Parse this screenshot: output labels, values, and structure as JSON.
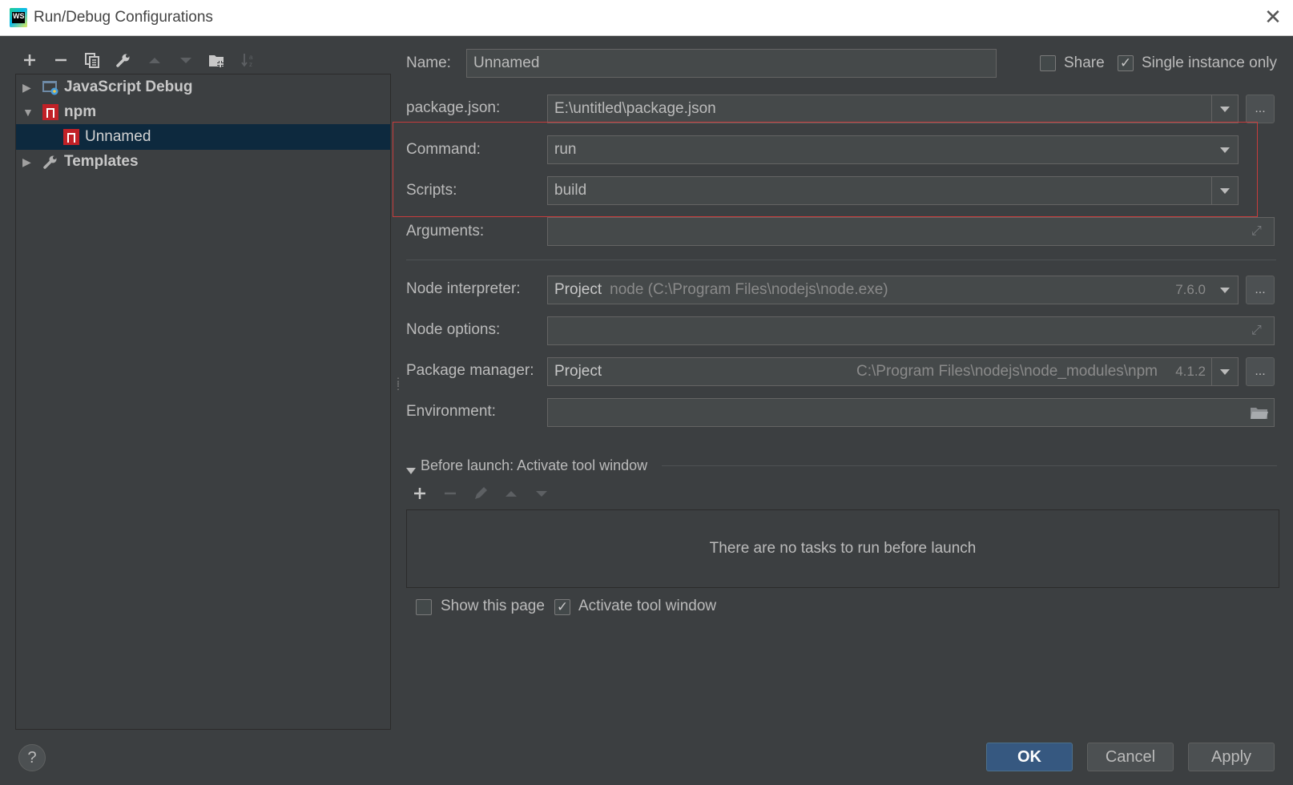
{
  "window": {
    "title": "Run/Debug Configurations",
    "logo_text": "WS"
  },
  "left_toolbar": [
    "add-icon",
    "remove-icon",
    "copy-icon",
    "wrench-icon",
    "move-up-icon",
    "move-down-icon",
    "new-folder-icon",
    "sort-icon"
  ],
  "tree": {
    "items": [
      {
        "label": "JavaScript Debug",
        "expanded": false
      },
      {
        "label": "npm",
        "expanded": true
      },
      {
        "label": "Unnamed",
        "selected": true
      },
      {
        "label": "Templates",
        "expanded": false
      }
    ]
  },
  "form": {
    "name_label": "Name:",
    "name_value": "Unnamed",
    "share_label": "Share",
    "share_checked": false,
    "single_instance_label": "Single instance only",
    "single_instance_checked": true,
    "package_json_label": "package.json:",
    "package_json_value": "E:\\untitled\\package.json",
    "command_label": "Command:",
    "command_value": "run",
    "scripts_label": "Scripts:",
    "scripts_value": "build",
    "arguments_label": "Arguments:",
    "arguments_value": "",
    "node_interpreter_label": "Node interpreter:",
    "node_interpreter_project": "Project",
    "node_interpreter_path": "node (C:\\Program Files\\nodejs\\node.exe)",
    "node_interpreter_version": "7.6.0",
    "node_options_label": "Node options:",
    "node_options_value": "",
    "package_manager_label": "Package manager:",
    "package_manager_project": "Project",
    "package_manager_path": "C:\\Program Files\\nodejs\\node_modules\\npm",
    "package_manager_version": "4.1.2",
    "environment_label": "Environment:",
    "environment_value": "",
    "dots": "..."
  },
  "before_launch": {
    "title": "Before launch: Activate tool window",
    "empty_text": "There are no tasks to run before launch",
    "show_page_label": "Show this page",
    "show_page_checked": false,
    "activate_label": "Activate tool window",
    "activate_checked": true
  },
  "buttons": {
    "ok": "OK",
    "cancel": "Cancel",
    "apply": "Apply",
    "help": "?"
  },
  "colors": {
    "background": "#3c3f41",
    "selection": "#0d293e",
    "ok_button": "#365880",
    "highlight_box": "#c73c3c",
    "npm_red": "#c12127"
  }
}
